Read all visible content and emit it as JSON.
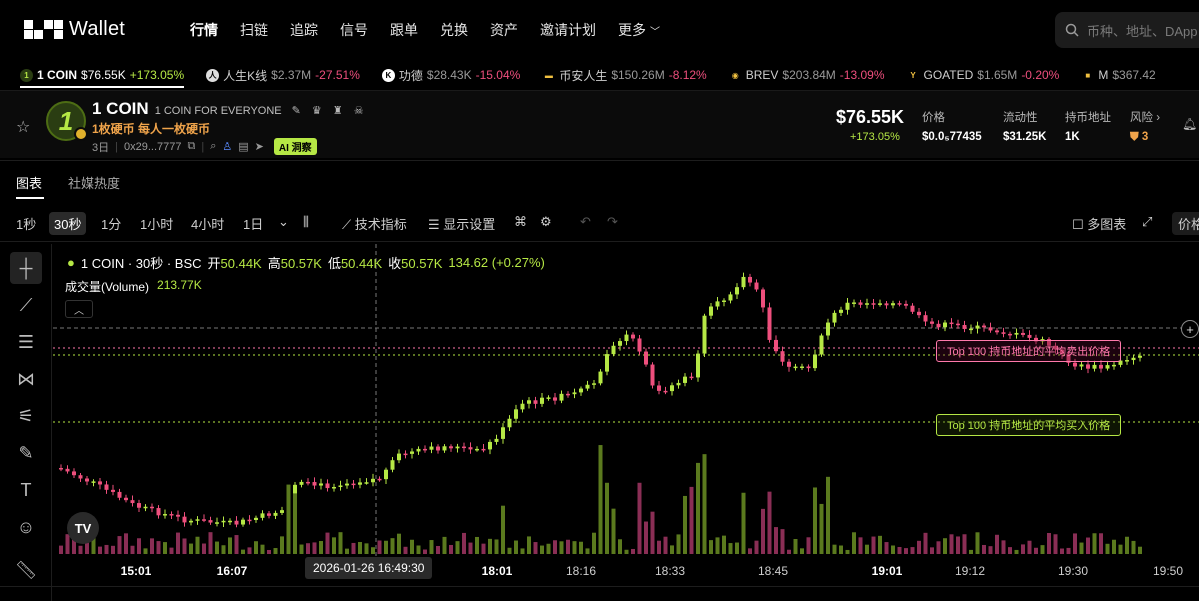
{
  "nav": {
    "brand": "Wallet",
    "menu": [
      "行情",
      "扫链",
      "追踪",
      "信号",
      "跟单",
      "兑换",
      "资产",
      "邀请计划"
    ],
    "more": "更多",
    "search_placeholder": "币种、地址、DApp"
  },
  "ticker": [
    {
      "name": "1 COIN",
      "price": "$76.55K",
      "change": "+173.05%",
      "dir": "up",
      "icon": "1",
      "icon_color": "#2a3d12"
    },
    {
      "name": "人生K线",
      "price": "$2.37M",
      "change": "-27.51%",
      "dir": "down",
      "icon": "人",
      "icon_color": "#ddd"
    },
    {
      "name": "功德",
      "price": "$28.43K",
      "change": "-15.04%",
      "dir": "down",
      "icon": "K",
      "icon_color": "#fff"
    },
    {
      "name": "币安人生",
      "price": "$150.26M",
      "change": "-8.12%",
      "dir": "down",
      "icon": "▬",
      "icon_color": "#000"
    },
    {
      "name": "BREV",
      "price": "$203.84M",
      "change": "-13.09%",
      "dir": "down",
      "icon": "◉",
      "icon_color": "#000"
    },
    {
      "name": "GOATED",
      "price": "$1.65M",
      "change": "-0.20%",
      "dir": "down",
      "icon": "Y",
      "icon_color": "#000"
    },
    {
      "name": "M",
      "price": "$367.42",
      "change": "",
      "dir": "down",
      "icon": "■",
      "icon_color": "#000"
    }
  ],
  "token": {
    "symbol": "1 COIN",
    "fullname": "1 COIN FOR EVERYONE",
    "cn_name": "1枚硬币 每人一枚硬币",
    "age": "3日",
    "address": "0x29...7777",
    "ai_badge": "AI 洞察",
    "price": "$76.55K",
    "change": "+173.05%",
    "stats": [
      {
        "label": "价格",
        "value": "$0.0₅77435"
      },
      {
        "label": "流动性",
        "value": "$31.25K"
      },
      {
        "label": "持币地址",
        "value": "1K"
      },
      {
        "label": "风险 ›",
        "value": "3"
      }
    ]
  },
  "tabs": [
    "图表",
    "社媒热度"
  ],
  "toolbar": {
    "intervals": [
      "1秒",
      "30秒",
      "1分",
      "1小时",
      "4小时",
      "1日"
    ],
    "selected_interval": "30秒",
    "indicators": "技术指标",
    "display_settings": "显示设置",
    "multi_chart": "多图表",
    "right_partial": "价格"
  },
  "legend": {
    "title": "1 COIN · 30秒 · BSC",
    "open_label": "开",
    "open": "50.44K",
    "high_label": "高",
    "high": "50.57K",
    "low_label": "低",
    "low": "50.44K",
    "close_label": "收",
    "close": "50.57K",
    "change": "134.62 (+0.27%)",
    "volume_label": "成交量(Volume)",
    "volume": "213.77K"
  },
  "labels": {
    "sell": "Top 100 持币地址的平均卖出价格",
    "buy": "Top 100 持币地址的平均买入价格"
  },
  "time_axis": {
    "ticks": [
      "15:01",
      "16:07",
      "18:01",
      "18:16",
      "18:33",
      "18:45",
      "19:01",
      "19:12",
      "19:30",
      "19:50"
    ],
    "bold": [
      "15:01",
      "16:07",
      "18:01",
      "19:01"
    ],
    "crosshair": "2026-01-26   16:49:30"
  },
  "colors": {
    "up": "#b6e845",
    "down": "#ee4f7d",
    "accent": "#b6e845",
    "sell": "#ff79ab",
    "risk": "#f0a44b"
  }
}
